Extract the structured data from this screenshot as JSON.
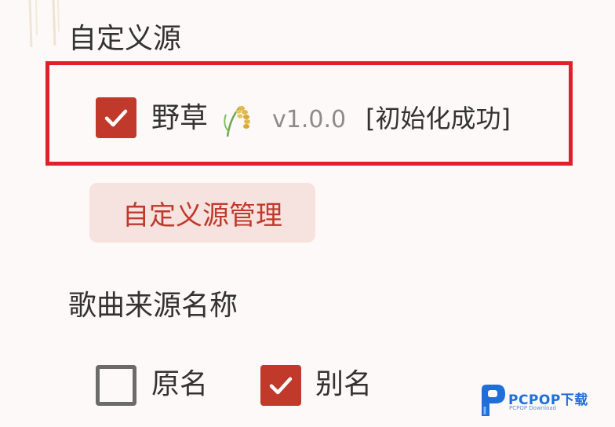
{
  "custom_source": {
    "section_title": "自定义源",
    "source": {
      "name": "野草",
      "version": "v1.0.0",
      "status": "[初始化成功]",
      "enabled": true,
      "icon": "rice-grain-icon"
    },
    "manage_button_label": "自定义源管理"
  },
  "song_source_name": {
    "section_title": "歌曲来源名称",
    "options": [
      {
        "label": "原名",
        "checked": false
      },
      {
        "label": "别名",
        "checked": true
      }
    ]
  },
  "watermark": {
    "brand": "PCPOP下载",
    "sub": "PCPOP Download"
  },
  "colors": {
    "accent": "#c0392b",
    "highlight_border": "#e0202a",
    "button_bg": "#f6e2df",
    "background": "#fcf9f8"
  }
}
